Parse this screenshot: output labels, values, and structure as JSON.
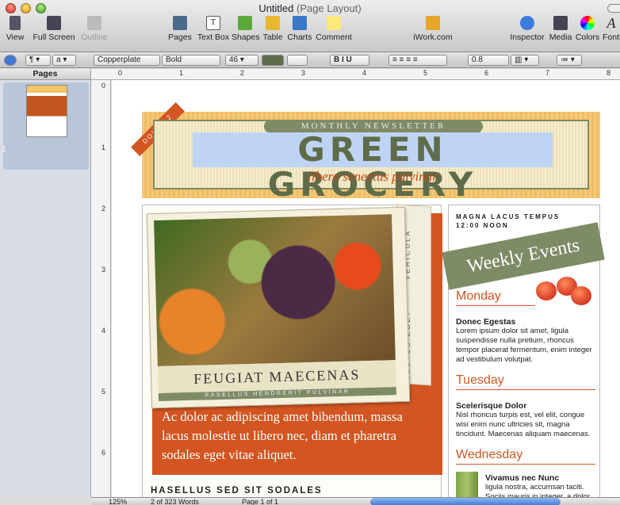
{
  "window": {
    "title": "Untitled",
    "subtitle": "(Page Layout)"
  },
  "toolbar": {
    "view": "View",
    "full_screen": "Full Screen",
    "outline": "Outline",
    "pages": "Pages",
    "text_box": "Text Box",
    "shapes": "Shapes",
    "table": "Table",
    "charts": "Charts",
    "comment": "Comment",
    "iwork": "iWork.com",
    "inspector": "Inspector",
    "media": "Media",
    "colors": "Colors",
    "fonts": "Fonts"
  },
  "formatbar": {
    "style": "¶",
    "char_style": "a",
    "font": "Copperplate",
    "typeface": "Bold",
    "size": "46",
    "line_spacing": "0.8"
  },
  "sidebar": {
    "header": "Pages",
    "page_number": "1"
  },
  "rulers": {
    "h": [
      "0",
      "1",
      "2",
      "3",
      "4",
      "5",
      "6",
      "7",
      "8"
    ],
    "v": [
      "0",
      "1",
      "2",
      "3",
      "4",
      "5",
      "6"
    ]
  },
  "newsletter": {
    "ribbon": "DOLOR 2",
    "monthly": "MONTHLY NEWSLETTER",
    "title": "GREEN GROCERY",
    "tagline": "libero senectus pulvinar",
    "photo_caption": "FEUGIAT MAECENAS",
    "photo_sub": "RASELLUS HENDRERIT PULVINAR",
    "side_text_top": "VEHICULA",
    "side_text_bottom": "LECTUS EGET",
    "body": "Ac dolor ac adipiscing amet bibendum, massa lacus molestie ut libero nec, diam et pharetra sodales eget vitae aliquet.",
    "section_heading": "HASELLUS SED SIT SODALES",
    "right_header_1": "MAGNA LACUS TEMPUS",
    "right_header_2": "12:00 NOON",
    "banner": "Weekly Events",
    "days": [
      {
        "day": "Monday",
        "title": "Donec Egestas",
        "text": "Lorem ipsum dolor sit amet, ligula suspendisse nulla pretium, rhoncus tempor placerat fermentum, enim integer ad vestibulum volutpat."
      },
      {
        "day": "Tuesday",
        "title": "Scelerisque Dolor",
        "text": "Nisl rhoncus turpis est, vel elit, congue wisi enim nunc ultricies sit, magna tincidunt. Maecenas aliquam maecenas."
      },
      {
        "day": "Wednesday",
        "title": "Vivamus nec Nunc",
        "text": "ligula nostra, accumsan taciti. Sociis mauris in integer, a dolor"
      }
    ]
  },
  "status": {
    "zoom": "125%",
    "words": "2 of 323 Words",
    "page": "Page 1 of 1"
  },
  "colors": {
    "accent": "#d35521",
    "olive": "#7d8b66",
    "highlight": "#bfd4f4"
  }
}
